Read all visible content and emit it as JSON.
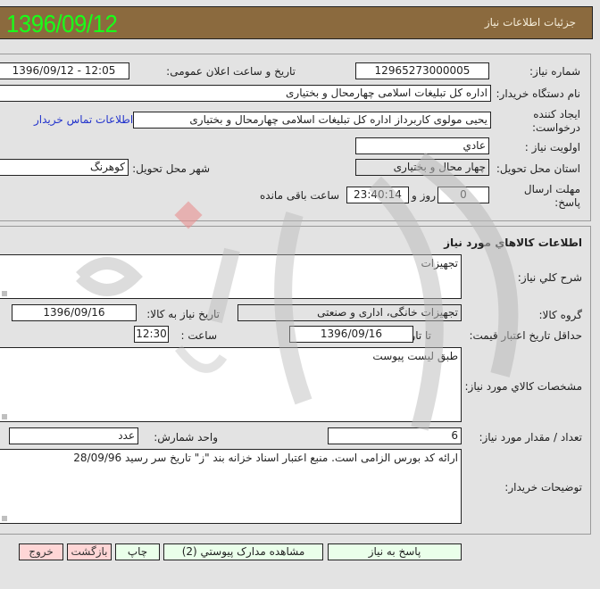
{
  "header": {
    "date": "1396/09/12",
    "title": "جزئیات اطلاعات نیاز"
  },
  "need_info": {
    "need_number_label": "شماره نیاز:",
    "need_number": "12965273000005",
    "announce_label": "تاریخ و ساعت اعلان عمومی:",
    "announce_value": "1396/09/12 - 12:05",
    "buyer_org_label": "نام دستگاه خریدار:",
    "buyer_org": "اداره کل تبلیغات اسلامی چهارمحال و بختیاری",
    "requester_label": "ایجاد کننده درخواست:",
    "requester": "یحیی مولوی کاربرداز اداره کل تبلیغات اسلامی چهارمحال و بختیاری",
    "buyer_contact_link": "اطلاعات تماس خریدار",
    "priority_label": "اولویت نیاز :",
    "priority": "عادي",
    "province_label": "استان محل تحویل:",
    "province": "چهار محال و بختیاری",
    "city_label": "شهر محل تحویل:",
    "city": "کوهرنگ",
    "deadline_label": "مهلت ارسال پاسخ:",
    "deadline_days": "0",
    "days_and_label": "روز و",
    "deadline_time": "23:40:14",
    "remaining_label": "ساعت باقی مانده"
  },
  "goods_info": {
    "section_title": "اطلاعات کالاهاي مورد نياز",
    "general_desc_label": "شرح کلي نياز:",
    "general_desc": "تجهیزات",
    "goods_group_label": "گروه کالا:",
    "goods_group": "تجهیزات خانگی، اداری و صنعتی",
    "need_date_label": "تاریخ نیاز به کالا:",
    "need_date": "1396/09/16",
    "price_validity_label": "حداقل تاریخ اعتبار قیمت:",
    "until_date_label": "تا تاریخ :",
    "until_date": "1396/09/16",
    "time_label": "ساعت :",
    "time_value": "12:30",
    "specs_label": "مشخصات کالاي مورد نياز:",
    "specs": "طبق لیست پیوست",
    "quantity_label": "تعداد / مقدار مورد نیاز:",
    "quantity": "6",
    "unit_label": "واحد شمارش:",
    "unit": "عدد",
    "buyer_notes_label": "توضیحات خریدار:",
    "buyer_notes": "ارائه کد بورس الزامی است. منبع اعتبار اسناد خزانه بند \"ز\" تاریخ سر رسید 28/09/96"
  },
  "buttons": {
    "respond": "پاسخ به نیاز",
    "attachments": "مشاهده مدارک پیوستي (2)",
    "print": "چاپ",
    "back": "بازگشت",
    "exit": "خروج"
  },
  "colors": {
    "header_bg": "#8b6a3e",
    "header_date": "#19ff19",
    "green_button": "#eaffea",
    "pink_button": "#ffd6d6",
    "link": "#2233cc"
  }
}
